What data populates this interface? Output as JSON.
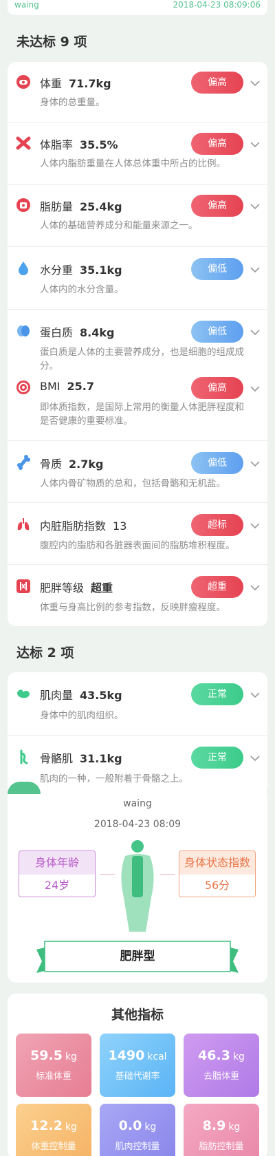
{
  "header": {
    "user_name": "waing",
    "timestamp": "2018-04-23 08:09:06"
  },
  "unmet": {
    "title": "未达标 9 项",
    "items": [
      {
        "name": "体重",
        "value": "71.7kg",
        "desc": "身体的总重量。",
        "status": "偏高",
        "icon": "scale-icon"
      },
      {
        "name": "体脂率",
        "value": "35.5%",
        "desc": "人体内脂肪重量在人体总体重中所占的比例。",
        "status": "偏高",
        "icon": "fat-rate-icon"
      },
      {
        "name": "脂肪量",
        "value": "25.4kg",
        "desc": "人体的基础营养成分和能量来源之一。",
        "status": "偏高",
        "icon": "fat-mass-icon"
      },
      {
        "name": "水分重",
        "value": "35.1kg",
        "desc": "人体内的水分含量。",
        "status": "偏低",
        "icon": "water-drop-icon"
      },
      {
        "name": "蛋白质",
        "value": "8.4kg",
        "desc": "蛋白质是人体的主要营养成分，也是细胞的组成成分。",
        "status": "偏低",
        "icon": "protein-icon"
      },
      {
        "name": "BMI",
        "value": "25.7",
        "desc": "即体质指数，是国际上常用的衡量人体肥胖程度和是否健康的重要标准。",
        "status": "偏高",
        "icon": "bmi-icon"
      },
      {
        "name": "骨质",
        "value": "2.7kg",
        "desc": "人体内骨矿物质的总和，包括骨骼和无机盐。",
        "status": "偏低",
        "icon": "bone-icon"
      },
      {
        "name": "内脏脂肪指数",
        "value": "13",
        "desc": "腹腔内的脂肪和各脏器表面间的脂肪堆积程度。",
        "status": "超标",
        "icon": "lungs-icon"
      },
      {
        "name": "肥胖等级",
        "value": "超重",
        "desc": "体重与身高比例的参考指数，反映胖瘦程度。",
        "status": "超重",
        "icon": "obesity-level-icon"
      }
    ]
  },
  "met": {
    "title": "达标 2 项",
    "items": [
      {
        "name": "肌肉量",
        "value": "43.5kg",
        "desc": "身体中的肌肉组织。",
        "status": "正常",
        "icon": "muscle-arm-icon"
      },
      {
        "name": "骨骼肌",
        "value": "31.1kg",
        "desc": "肌肉的一种，一般附着于骨骼之上。",
        "status": "正常",
        "icon": "skeletal-muscle-icon"
      }
    ]
  },
  "summary": {
    "user_name": "waing",
    "timestamp": "2018-04-23 08:09",
    "body_age_label": "身体年龄",
    "body_age_value": "24岁",
    "body_score_label": "身体状态指数",
    "body_score_value": "56分",
    "body_type": "肥胖型"
  },
  "other": {
    "title": "其他指标",
    "stats": [
      {
        "value": "59.5",
        "unit": "kg",
        "label": "标准体重"
      },
      {
        "value": "1490",
        "unit": "kcal",
        "label": "基础代谢率"
      },
      {
        "value": "46.3",
        "unit": "kg",
        "label": "去脂体重"
      },
      {
        "value": "12.2",
        "unit": "kg",
        "label": "体重控制量"
      },
      {
        "value": "0.0",
        "unit": "kg",
        "label": "肌肉控制量"
      },
      {
        "value": "8.9",
        "unit": "kg",
        "label": "脂肪控制量"
      }
    ]
  },
  "colors": {
    "high": "#e54352",
    "low": "#5d9ff0",
    "normal": "#3ccb8a",
    "accent": "#55c38e"
  }
}
